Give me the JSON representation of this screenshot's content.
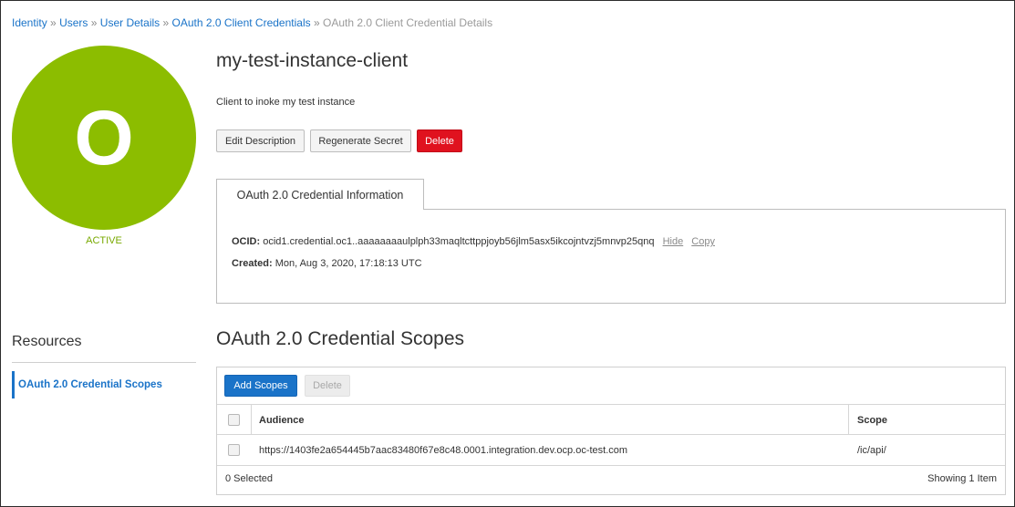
{
  "breadcrumb": {
    "items": [
      "Identity",
      "Users",
      "User Details",
      "OAuth 2.0 Client Credentials"
    ],
    "separator": "»",
    "current": "OAuth 2.0 Client Credential Details"
  },
  "avatar": {
    "letter": "O",
    "color": "#8cbd00",
    "status": "ACTIVE"
  },
  "resources": {
    "title": "Resources",
    "items": [
      {
        "label": "OAuth 2.0 Credential Scopes",
        "selected": true
      }
    ]
  },
  "header": {
    "title": "my-test-instance-client",
    "description": "Client to inoke my test instance",
    "buttons": {
      "edit_description": "Edit Description",
      "regenerate_secret": "Regenerate Secret",
      "delete": "Delete"
    }
  },
  "info_tab": {
    "label": "OAuth 2.0 Credential Information",
    "ocid_label": "OCID:",
    "ocid_value": "ocid1.credential.oc1..aaaaaaaaulplph33maqltcttppjoyb56jlm5asx5ikcojntvzj5mnvp25qnq",
    "hide_link": "Hide",
    "copy_link": "Copy",
    "created_label": "Created:",
    "created_value": "Mon, Aug 3, 2020, 17:18:13 UTC"
  },
  "scopes": {
    "title": "OAuth 2.0 Credential Scopes",
    "add_button": "Add Scopes",
    "delete_button": "Delete",
    "columns": [
      "Audience",
      "Scope"
    ],
    "rows": [
      {
        "audience": "https://1403fe2a654445b7aac83480f67e8c48.0001.integration.dev.ocp.oc-test.com",
        "scope": "/ic/api/"
      }
    ],
    "selected_text": "0 Selected",
    "count_text": "Showing 1 Item"
  },
  "colors": {
    "link": "#1a73c8",
    "primary_button": "#1a73c8",
    "danger_button": "#e0121f",
    "active_status": "#78a900"
  }
}
